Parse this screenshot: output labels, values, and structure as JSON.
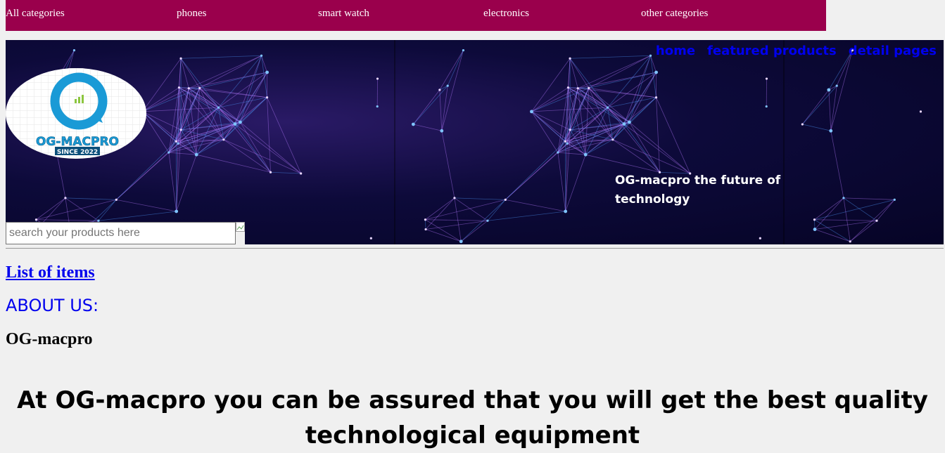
{
  "top_nav": {
    "categories": [
      {
        "label": "All categories"
      },
      {
        "label": "phones"
      },
      {
        "label": "smart watch"
      },
      {
        "label": "electronics"
      },
      {
        "label": "other categories"
      }
    ],
    "background_color": "#9a004c"
  },
  "header": {
    "nav_links": [
      {
        "label": "home"
      },
      {
        "label": "featured products"
      },
      {
        "label": "detail pages"
      }
    ],
    "logo": {
      "brand_text": "OG-MACPRO",
      "since_text": "SINCE 2022"
    },
    "tagline": "OG-macpro the future of technology"
  },
  "search": {
    "placeholder": "search your products here",
    "value": ""
  },
  "main": {
    "list_link": "List of items",
    "about_heading": "ABOUT US:",
    "brand_name": "OG-macpro",
    "statement": "At OG-macpro you can be assured that you will get the best quality technological equipment"
  },
  "colors": {
    "link": "#0000ee",
    "banner": "#0d0a3a",
    "logo_blue": "#1a9ad6"
  }
}
